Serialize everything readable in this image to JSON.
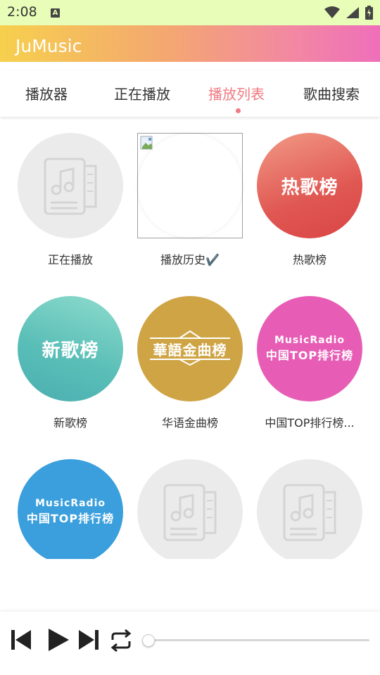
{
  "status_bar": {
    "time": "2:08",
    "notif_letter": "A"
  },
  "app": {
    "title": "JuMusic"
  },
  "tabs": [
    {
      "label": "播放器",
      "active": false
    },
    {
      "label": "正在播放",
      "active": false
    },
    {
      "label": "播放列表",
      "active": true
    },
    {
      "label": "歌曲搜索",
      "active": false
    }
  ],
  "playlists": [
    {
      "label": "正在播放",
      "cover": "placeholder"
    },
    {
      "label": "播放历史✔️",
      "cover": "broken-image"
    },
    {
      "label": "热歌榜",
      "cover_text": "热歌榜",
      "color": "#e05752"
    },
    {
      "label": "新歌榜",
      "cover_text": "新歌榜",
      "color": "#5bbfb8"
    },
    {
      "label": "华语金曲榜",
      "cover_text": "華語金曲榜",
      "color": "#cfa445"
    },
    {
      "label": "中国TOP排行榜...",
      "cover_text_top": "MusicRadio",
      "cover_text_bottom": "中国TOP排行榜",
      "color": "#e75db5"
    },
    {
      "label": "",
      "cover_text_top": "MusicRadio",
      "cover_text_bottom": "中国TOP排行榜",
      "color": "#3a9fdc"
    },
    {
      "label": "",
      "cover": "placeholder"
    },
    {
      "label": "",
      "cover": "placeholder"
    }
  ],
  "player": {
    "progress": 0
  }
}
